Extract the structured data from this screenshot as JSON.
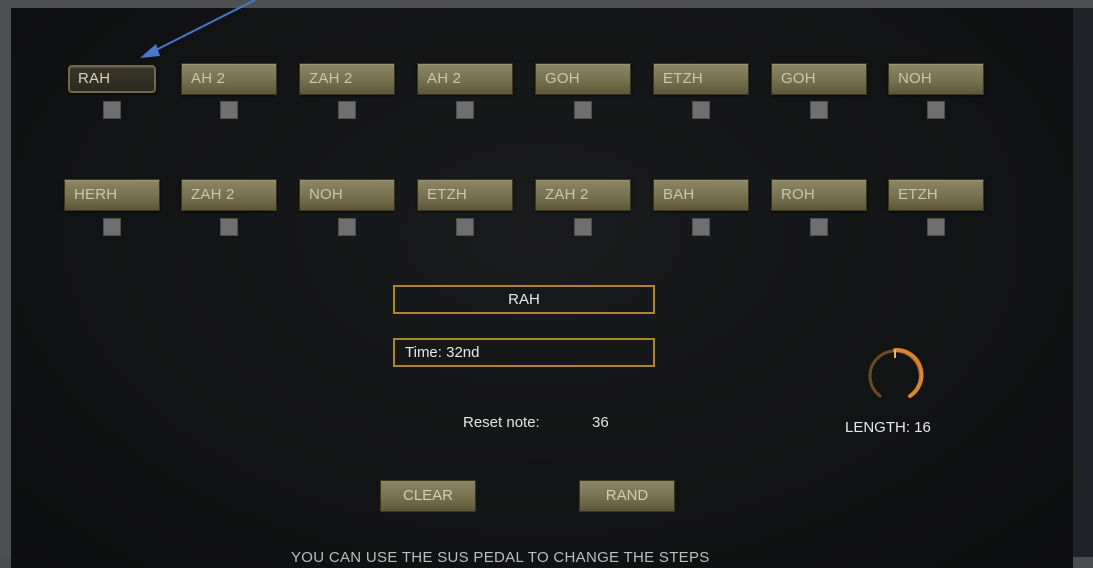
{
  "steps_row1": [
    {
      "label": "RAH",
      "selected": true
    },
    {
      "label": "AH 2"
    },
    {
      "label": "ZAH 2"
    },
    {
      "label": "AH 2"
    },
    {
      "label": "GOH"
    },
    {
      "label": "ETZH"
    },
    {
      "label": "GOH"
    },
    {
      "label": "NOH"
    }
  ],
  "steps_row2": [
    {
      "label": "HERH"
    },
    {
      "label": "ZAH 2"
    },
    {
      "label": "NOH"
    },
    {
      "label": "ETZH"
    },
    {
      "label": "ZAH 2"
    },
    {
      "label": "BAH"
    },
    {
      "label": "ROH"
    },
    {
      "label": "ETZH"
    }
  ],
  "note_display": "RAH",
  "time_display": "Time: 32nd",
  "reset": {
    "label": "Reset note:",
    "value": "36"
  },
  "length": {
    "label": "LENGTH: 16",
    "value": 16
  },
  "buttons": {
    "clear": "CLEAR",
    "rand": "RAND"
  },
  "footer_text": "YOU CAN USE THE SUS PEDAL TO CHANGE THE STEPS",
  "colors": {
    "accent": "#a8872f",
    "knob": "#d9852c",
    "annotation_arrow": "#4a78c8"
  }
}
